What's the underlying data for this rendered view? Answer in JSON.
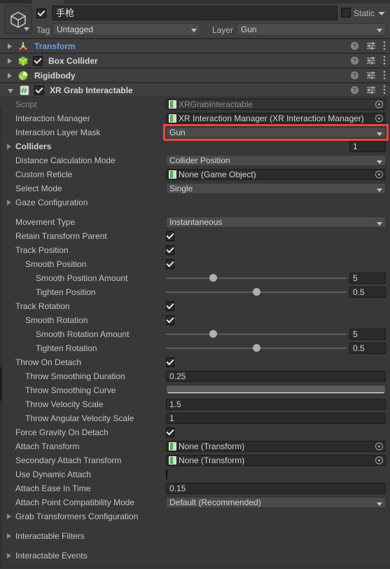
{
  "header": {
    "object_name": "手枪",
    "object_enabled": true,
    "static_label": "Static",
    "static_checked": false,
    "tag_label": "Tag",
    "tag_value": "Untagged",
    "layer_label": "Layer",
    "layer_value": "Gun",
    "gameobject_icon": "cube-icon"
  },
  "components": [
    {
      "name": "Transform",
      "icon": "transform-icon",
      "expanded": false,
      "has_enable_toggle": false,
      "enabled": false,
      "is_link": true
    },
    {
      "name": "Box Collider",
      "icon": "box-collider-icon",
      "expanded": false,
      "has_enable_toggle": true,
      "enabled": true,
      "is_link": false
    },
    {
      "name": "Rigidbody",
      "icon": "rigidbody-icon",
      "expanded": false,
      "has_enable_toggle": false,
      "enabled": false,
      "is_link": false
    },
    {
      "name": "XR Grab Interactable",
      "icon": "script-icon",
      "expanded": true,
      "has_enable_toggle": true,
      "enabled": true,
      "is_link": false
    }
  ],
  "header_icons": {
    "help": "help-icon",
    "preset": "preset-icon",
    "menu": "kebab-menu-icon"
  },
  "properties": [
    {
      "label": "Script",
      "indent": 0,
      "dim": true,
      "type": "object",
      "value": "XRGrabInteractable",
      "readonly": true
    },
    {
      "label": "Interaction Manager",
      "indent": 0,
      "type": "object",
      "value": "XR Interaction Manager (XR Interaction Manager)",
      "readonly": false
    },
    {
      "label": "Interaction Layer Mask",
      "indent": 0,
      "type": "dropdown",
      "value": "Gun",
      "highlighted": true
    },
    {
      "label": "Colliders",
      "indent": 0,
      "bold": true,
      "foldout": true,
      "type": "count",
      "value": "1"
    },
    {
      "label": "Distance Calculation Mode",
      "indent": 0,
      "type": "dropdown",
      "value": "Collider Position"
    },
    {
      "label": "Custom Reticle",
      "indent": 0,
      "type": "object",
      "value": "None (Game Object)"
    },
    {
      "label": "Select Mode",
      "indent": 0,
      "type": "dropdown",
      "value": "Single"
    },
    {
      "label": "Gaze Configuration",
      "indent": 0,
      "foldout": true,
      "type": "none"
    },
    {
      "type": "spacer"
    },
    {
      "label": "Movement Type",
      "indent": 0,
      "type": "dropdown",
      "value": "Instantaneous"
    },
    {
      "label": "Retain Transform Parent",
      "indent": 0,
      "type": "checkbox",
      "checked": true
    },
    {
      "label": "Track Position",
      "indent": 0,
      "type": "checkbox",
      "checked": true
    },
    {
      "label": "Smooth Position",
      "indent": 1,
      "type": "checkbox",
      "checked": true
    },
    {
      "label": "Smooth Position Amount",
      "indent": 2,
      "type": "slider",
      "value": "5",
      "fraction": 0.26
    },
    {
      "label": "Tighten Position",
      "indent": 2,
      "type": "slider",
      "value": "0.5",
      "fraction": 0.5
    },
    {
      "label": "Track Rotation",
      "indent": 0,
      "type": "checkbox",
      "checked": true
    },
    {
      "label": "Smooth Rotation",
      "indent": 1,
      "type": "checkbox",
      "checked": true
    },
    {
      "label": "Smooth Rotation Amount",
      "indent": 2,
      "type": "slider",
      "value": "5",
      "fraction": 0.26
    },
    {
      "label": "Tighten Rotation",
      "indent": 2,
      "type": "slider",
      "value": "0.5",
      "fraction": 0.5
    },
    {
      "label": "Throw On Detach",
      "indent": 0,
      "type": "checkbox",
      "checked": true
    },
    {
      "label": "Throw Smoothing Duration",
      "indent": 1,
      "type": "number",
      "value": "0.25"
    },
    {
      "label": "Throw Smoothing Curve",
      "indent": 1,
      "type": "curve"
    },
    {
      "label": "Throw Velocity Scale",
      "indent": 1,
      "type": "number",
      "value": "1.5"
    },
    {
      "label": "Throw Angular Velocity Scale",
      "indent": 1,
      "type": "number",
      "value": "1"
    },
    {
      "label": "Force Gravity On Detach",
      "indent": 0,
      "type": "checkbox",
      "checked": true
    },
    {
      "label": "Attach Transform",
      "indent": 0,
      "type": "object",
      "value": "None (Transform)"
    },
    {
      "label": "Secondary Attach Transform",
      "indent": 0,
      "type": "object",
      "value": "None (Transform)"
    },
    {
      "label": "Use Dynamic Attach",
      "indent": 0,
      "type": "checkbox",
      "checked": false
    },
    {
      "label": "Attach Ease In Time",
      "indent": 0,
      "type": "number",
      "value": "0.15"
    },
    {
      "label": "Attach Point Compatibility Mode",
      "indent": 0,
      "type": "dropdown",
      "value": "Default (Recommended)"
    },
    {
      "label": "Grab Transformers Configuration",
      "indent": 0,
      "foldout": true,
      "type": "none"
    },
    {
      "type": "spacer"
    },
    {
      "label": "Interactable Filters",
      "indent": 0,
      "foldout": true,
      "type": "none"
    },
    {
      "type": "spacer"
    },
    {
      "label": "Interactable Events",
      "indent": 0,
      "foldout": true,
      "type": "none"
    }
  ],
  "colors": {
    "background": "#383838",
    "header_bar": "#414141",
    "component_header": "#3f3f3f",
    "field_dark": "#2b2b2b",
    "dropdown": "#4b4b4b",
    "text": "#c4c4c4",
    "link": "#6d9eeb",
    "highlight": "#f2453d",
    "accent_green": "#8ec63f"
  }
}
